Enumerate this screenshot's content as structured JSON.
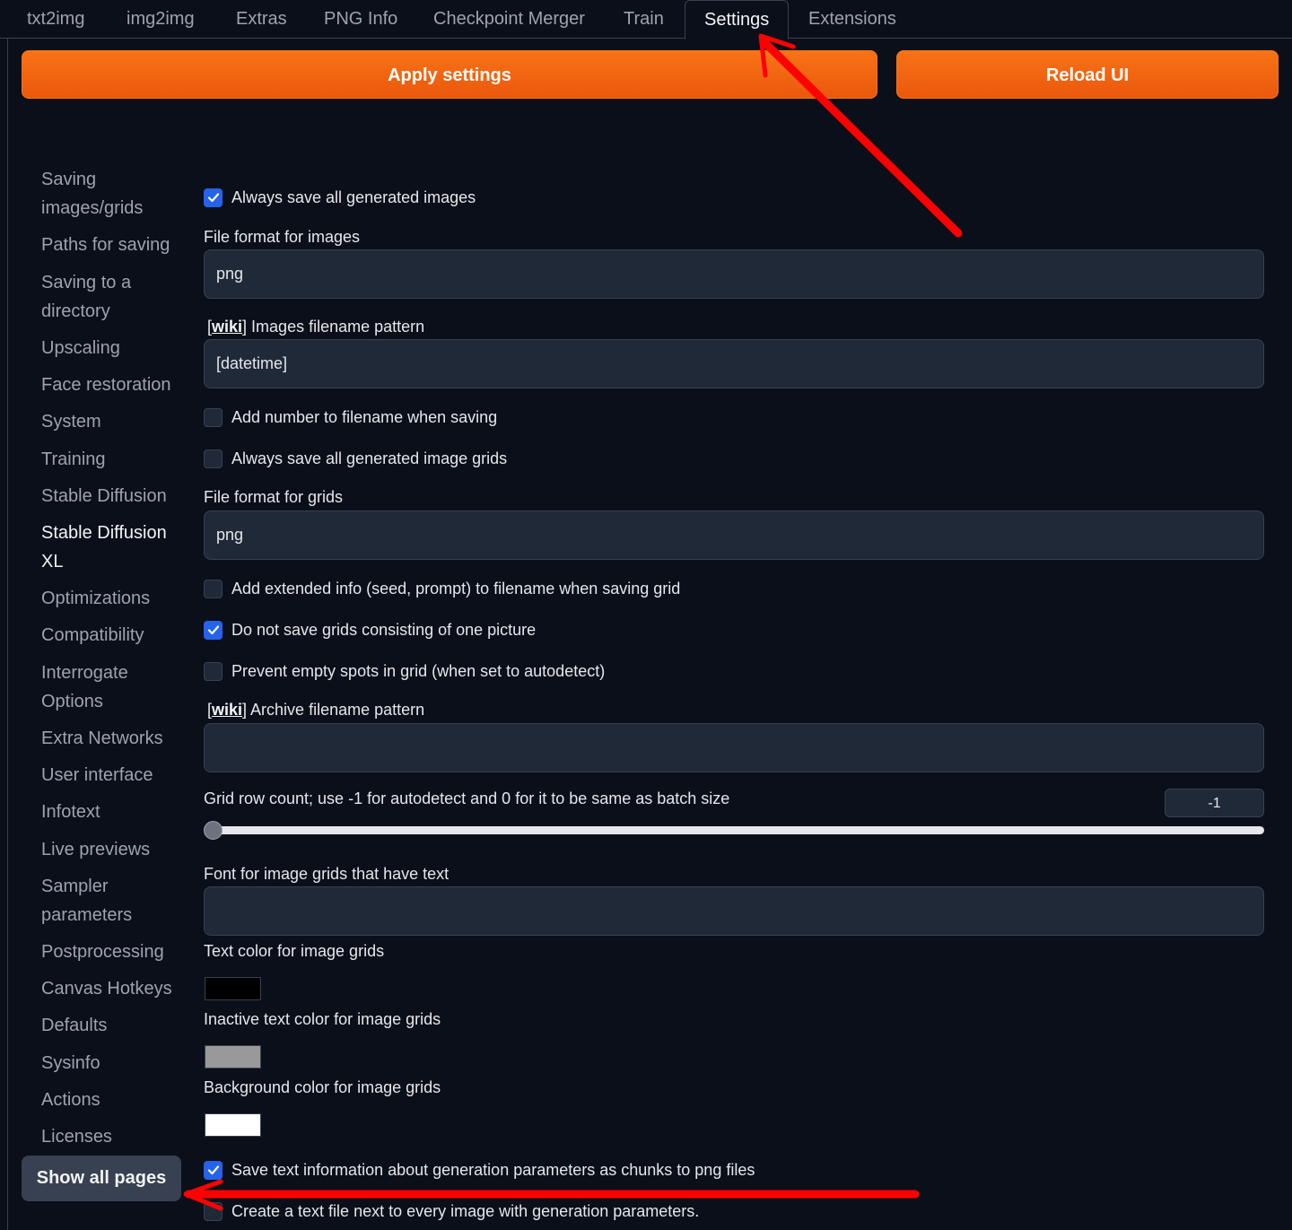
{
  "tabs": [
    {
      "label": "txt2img"
    },
    {
      "label": "img2img"
    },
    {
      "label": "Extras"
    },
    {
      "label": "PNG Info"
    },
    {
      "label": "Checkpoint Merger"
    },
    {
      "label": "Train"
    },
    {
      "label": "Settings",
      "active": true
    },
    {
      "label": "Extensions"
    }
  ],
  "actions": {
    "apply_label": "Apply settings",
    "reload_label": "Reload UI"
  },
  "sidebar": {
    "items": [
      {
        "label": "Saving images/grids"
      },
      {
        "label": "Paths for saving"
      },
      {
        "label": "Saving to a directory"
      },
      {
        "label": "Upscaling"
      },
      {
        "label": "Face restoration"
      },
      {
        "label": "System"
      },
      {
        "label": "Training"
      },
      {
        "label": "Stable Diffusion"
      },
      {
        "label": "Stable Diffusion XL",
        "active": true
      },
      {
        "label": "Optimizations"
      },
      {
        "label": "Compatibility"
      },
      {
        "label": "Interrogate Options"
      },
      {
        "label": "Extra Networks"
      },
      {
        "label": "User interface"
      },
      {
        "label": "Infotext"
      },
      {
        "label": "Live previews"
      },
      {
        "label": "Sampler parameters"
      },
      {
        "label": "Postprocessing"
      },
      {
        "label": "Canvas Hotkeys"
      },
      {
        "label": "Defaults"
      },
      {
        "label": "Sysinfo"
      },
      {
        "label": "Actions"
      },
      {
        "label": "Licenses"
      }
    ],
    "show_all_label": "Show all pages"
  },
  "settings": {
    "always_save_images": {
      "label": "Always save all generated images",
      "checked": true
    },
    "file_format_images": {
      "label": "File format for images",
      "value": "png"
    },
    "images_filename_pattern": {
      "wiki": "wiki",
      "label": "Images filename pattern",
      "value": "[datetime]"
    },
    "add_number": {
      "label": "Add number to filename when saving",
      "checked": false
    },
    "always_save_grids": {
      "label": "Always save all generated image grids",
      "checked": false
    },
    "file_format_grids": {
      "label": "File format for grids",
      "value": "png"
    },
    "add_extended_info": {
      "label": "Add extended info (seed, prompt) to filename when saving grid",
      "checked": false
    },
    "no_single_grids": {
      "label": "Do not save grids consisting of one picture",
      "checked": true
    },
    "prevent_empty_spots": {
      "label": "Prevent empty spots in grid (when set to autodetect)",
      "checked": false
    },
    "archive_filename_pattern": {
      "wiki": "wiki",
      "label": "Archive filename pattern",
      "value": ""
    },
    "grid_row_count": {
      "label": "Grid row count; use -1 for autodetect and 0 for it to be same as batch size",
      "value": "-1",
      "min": -1,
      "max": 16
    },
    "grid_font": {
      "label": "Font for image grids that have text",
      "value": ""
    },
    "text_color": {
      "label": "Text color for image grids",
      "color": "#000000"
    },
    "inactive_text_color": {
      "label": "Inactive text color for image grids",
      "color": "#999999"
    },
    "background_color": {
      "label": "Background color for image grids",
      "color": "#ffffff"
    },
    "save_pnginfo": {
      "label": "Save text information about generation parameters as chunks to png files",
      "checked": true
    },
    "create_txt": {
      "label": "Create a text file next to every image with generation parameters.",
      "checked": false
    }
  },
  "annotation_color": "#ff0000"
}
